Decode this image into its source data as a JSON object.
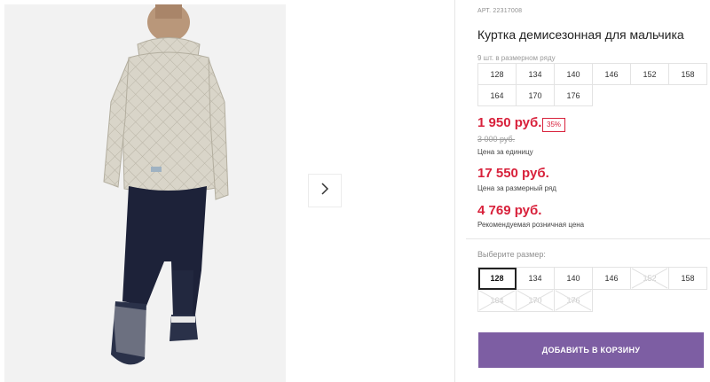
{
  "gallery": {
    "photo_alt": "Product photo",
    "next_icon": "chevron-right-icon"
  },
  "product": {
    "article": "АРТ. 22317008",
    "title": "Куртка демисезонная для мальчика",
    "pieces_in_row": "9 шт. в размерном ряду",
    "row_sizes": [
      "128",
      "134",
      "140",
      "146",
      "152",
      "158",
      "164",
      "170",
      "176"
    ]
  },
  "pricing": {
    "unit_price": "1 950 руб.",
    "discount": "35%",
    "old_price": "3 000 руб.",
    "unit_label": "Цена за единицу",
    "row_price": "17 550 руб.",
    "row_label": "Цена за размерный ряд",
    "retail_price": "4 769 руб.",
    "retail_label": "Рекомендуемая розничная цена"
  },
  "size_select": {
    "label": "Выберите размер:",
    "selected": "128",
    "options": [
      {
        "size": "128",
        "available": true
      },
      {
        "size": "134",
        "available": true
      },
      {
        "size": "140",
        "available": true
      },
      {
        "size": "146",
        "available": true
      },
      {
        "size": "152",
        "available": false
      },
      {
        "size": "158",
        "available": true
      },
      {
        "size": "164",
        "available": false
      },
      {
        "size": "170",
        "available": false
      },
      {
        "size": "176",
        "available": false
      }
    ]
  },
  "actions": {
    "add_to_cart": "ДОБАВИТЬ В КОРЗИНУ"
  },
  "colors": {
    "price_red": "#d8213b",
    "button_purple": "#7d5ea3"
  }
}
